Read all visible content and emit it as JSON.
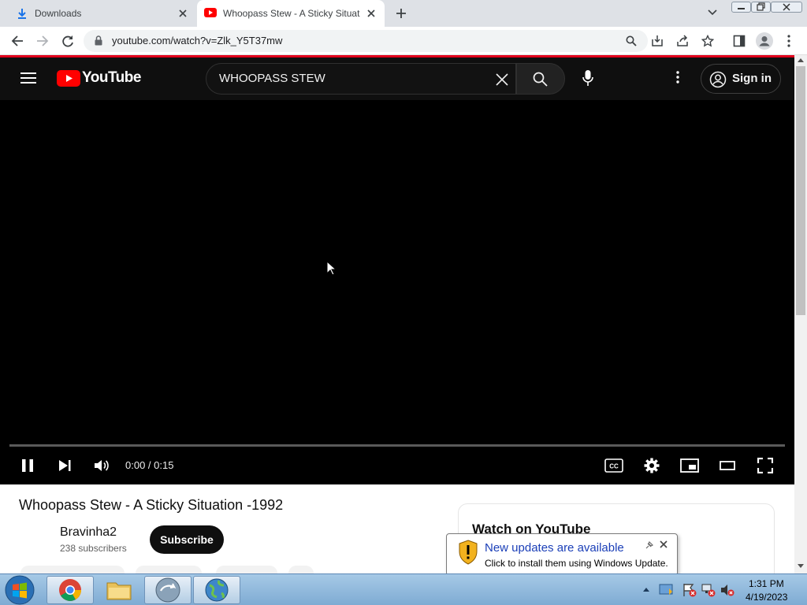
{
  "window": {
    "minimize_icon": "minimize-icon",
    "maximize_icon": "restore-icon",
    "close_icon": "close-icon"
  },
  "tabs": [
    {
      "title": "Downloads",
      "icon": "download-icon",
      "active": false
    },
    {
      "title": "Whoopass Stew - A Sticky Situation",
      "icon": "youtube-icon",
      "active": true
    }
  ],
  "toolbar": {
    "url": "youtube.com/watch?v=Zlk_Y5T37mw"
  },
  "youtube": {
    "logo_text": "YouTube",
    "search_value": "WHOOPASS STEW",
    "sign_in_label": "Sign in",
    "accent_color": "#ff0000"
  },
  "player": {
    "timecode": "0:00 / 0:15",
    "cc_label": "CC",
    "progress_fraction": 0
  },
  "video": {
    "title": "Whoopass Stew - A Sticky Situation -1992",
    "channel": "Bravinha2",
    "subscribers": "238 subscribers",
    "subscribe_label": "Subscribe"
  },
  "sidebar_card": {
    "title": "Watch on YouTube"
  },
  "notification": {
    "title": "New updates are available",
    "text": "Click to install them using Windows Update."
  },
  "taskbar": {
    "time": "1:31 PM",
    "date": "4/19/2023"
  }
}
